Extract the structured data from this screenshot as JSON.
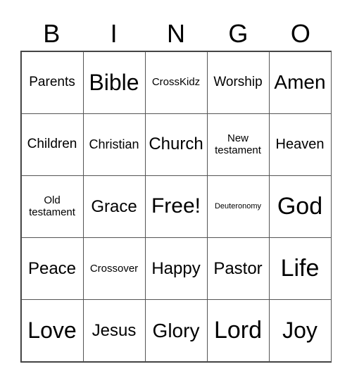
{
  "header": [
    "B",
    "I",
    "N",
    "G",
    "O"
  ],
  "cells": [
    [
      "Parents",
      "Bible",
      "CrossKidz",
      "Worship",
      "Amen"
    ],
    [
      "Children",
      "Christian",
      "Church",
      "New testament",
      "Heaven"
    ],
    [
      "Old testament",
      "Grace",
      "Free!",
      "Deuteronomy",
      "God"
    ],
    [
      "Peace",
      "Crossover",
      "Happy",
      "Pastor",
      "Life"
    ],
    [
      "Love",
      "Jesus",
      "Glory",
      "Lord",
      "Joy"
    ]
  ]
}
